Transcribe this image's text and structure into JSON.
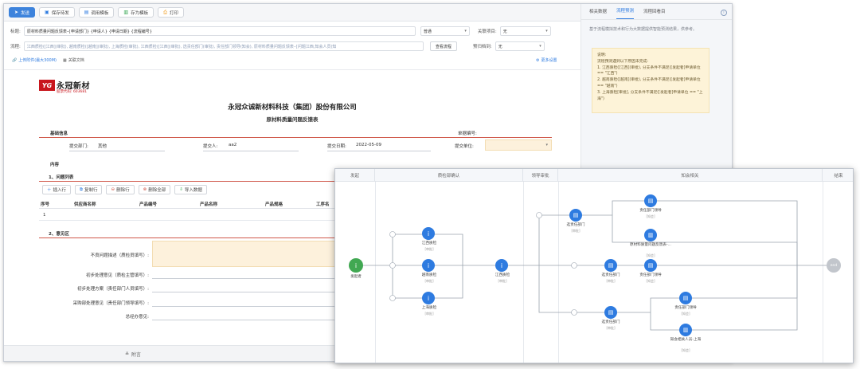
{
  "toolbar": {
    "send": "发送",
    "save_draft": "保存待发",
    "use_template": "调用模板",
    "save_template": "存为模板",
    "print": "打印"
  },
  "form": {
    "title_label": "标题:",
    "title_value": "原材料质量问题反馈表-{申请部门} {申请人} {申请日期} {流程编号}",
    "priority_value": "普通",
    "related_project_label": "关联项目:",
    "related_project_value": "无",
    "flow_label": "流程:",
    "flow_value": "江西质检([江西](审批), 越南质检([越南](审批), 上海质检(审批), 江西质检([江西](审批), 选责任部门(审批), 责任部门领导(知会), 原材料质量问题反馈表-{问题江西,知会人员(知",
    "view_flow_button": "查看流程",
    "predict_label": "预归档到:",
    "predict_value": "无",
    "upload_attachment": "上传附件(最大300M)",
    "related_doc": "关联文档",
    "more_settings": "更多设置"
  },
  "doc": {
    "logo_mark": "YG",
    "logo_name": "永冠新材",
    "logo_code": "股票代码: 603681",
    "company": "永冠众诚新材料科技（集团）股份有限公司",
    "subtitle": "原材料质量问题反馈表",
    "basic_info": "基础信息",
    "serial_label": "单据编号:",
    "dept_label": "提交部门:",
    "dept_value": "其他",
    "submitter_label": "提交人:",
    "submitter_value": "aa2",
    "date_label": "提交日期:",
    "date_value": "2022-05-09",
    "unit_label": "提交单位:",
    "content_label": "内容",
    "problem_list": "1、问题列表",
    "grid_buttons": [
      "插入行",
      "复制行",
      "删除行",
      "删除全部",
      "导入数据"
    ],
    "table_headers": [
      "序号",
      "供应商名称",
      "产品编号",
      "产品名称",
      "产品规格",
      "工序名"
    ],
    "row1_index": "1",
    "opinion_section": "2、意见区",
    "opinion_labels": [
      "不良问题描述（质检员填写）:",
      "初步处理意见（质检主管填写）:",
      "初步处理方案（责任部门人员填写）:",
      "采购部处理意见（责任部门领导填写）:",
      "总经办意见:"
    ],
    "footer_attachment": "附言"
  },
  "right_panel": {
    "tabs": [
      "相关数据",
      "流程预测",
      "流程回看目"
    ],
    "active_tab": 1,
    "desc": "基于流程模拟技术和行为大数据提供智能预测结果，供参考。",
    "note_title": "说明:",
    "note_lines": [
      "流程预测遇到以下原因未完成:",
      "1. 江西质检([江西](审批), 分支条件不满足([发起者]申请单位 == \"江西\")",
      "2. 越南质检([越南](审批), 分支条件不满足([发起者]申请单位 == \"越南\")",
      "3. 上海质检[审批], 分支条件不满足([发起者]申请单位 == \"上海\")"
    ]
  },
  "flow": {
    "lanes": [
      "发起",
      "质检部确认",
      "领导审批",
      "知会相关",
      "结束"
    ],
    "nodes": {
      "start": {
        "label": "发起者"
      },
      "jx1": {
        "label": "江西质检",
        "tag": "[审批]"
      },
      "yn": {
        "label": "越南质检",
        "tag": "[审批]"
      },
      "sh": {
        "label": "上海质检",
        "tag": "[审批]"
      },
      "jx2": {
        "label": "江西质检",
        "tag": "[审批]"
      },
      "sel1": {
        "label": "选责任部门",
        "tag": "[审批]"
      },
      "sel2": {
        "label": "选责任部门",
        "tag": "[审批]"
      },
      "sel3": {
        "label": "选责任部门",
        "tag": "[审批]"
      },
      "lead1": {
        "label": "责任部门领导",
        "tag": "[知会]"
      },
      "lead2": {
        "label": "责任部门领导",
        "tag": "[知会]"
      },
      "lead3": {
        "label": "责任部门领导",
        "tag": "[知会]"
      },
      "rawmat": {
        "label": "原材料质量问题反馈表-...",
        "tag": "[知会]"
      },
      "notify": {
        "label": "知会相关人员-上海",
        "tag": "[知会]"
      },
      "end": {
        "label": "end"
      }
    },
    "branch_marks": [
      "分支",
      "分支",
      "分支",
      "分支",
      "分支",
      "分支"
    ]
  },
  "colors": {
    "primary": "#3d83dc",
    "red_line": "#d0584a",
    "node_blue": "#2e7be0",
    "node_green": "#41a852",
    "end_gray": "#c2c6cc",
    "note_bg": "#fdf3d8"
  }
}
